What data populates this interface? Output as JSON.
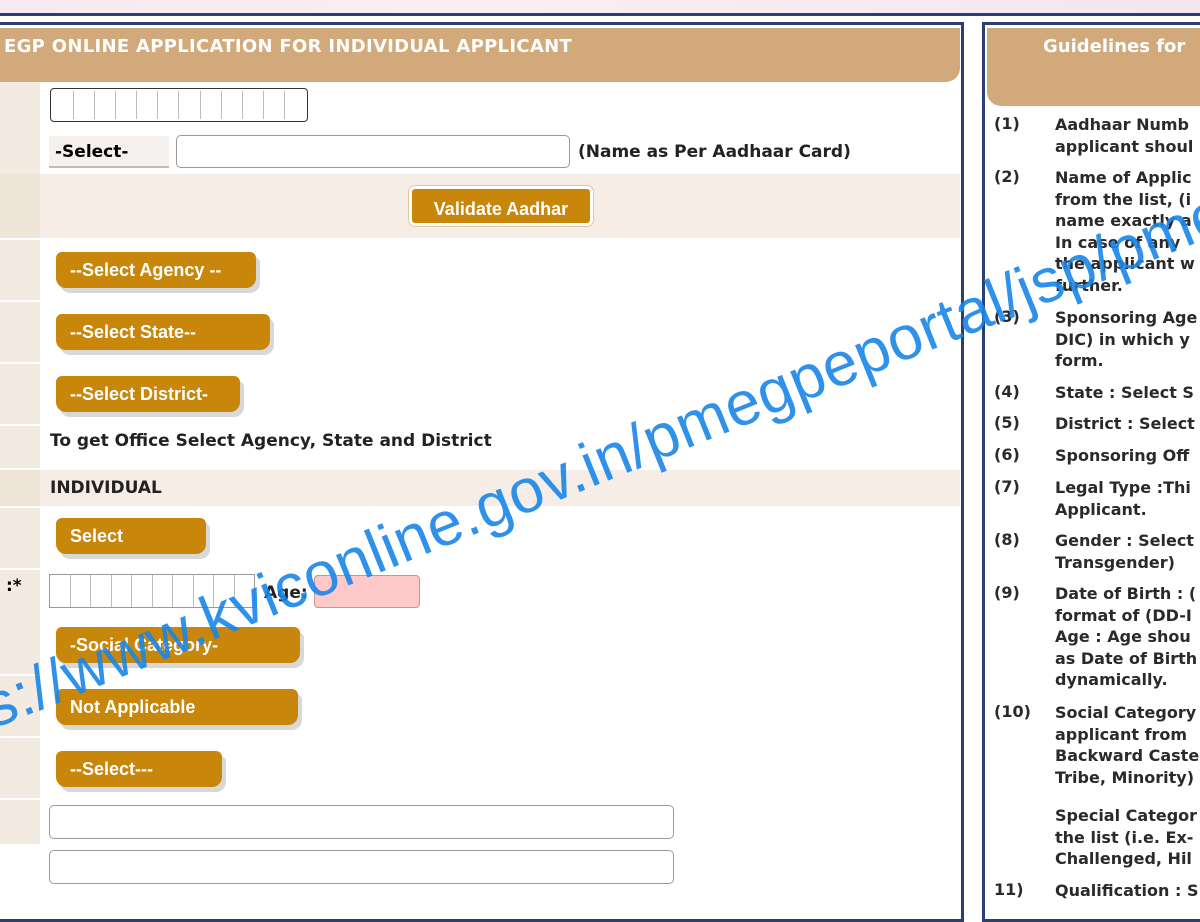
{
  "form": {
    "title": "EGP ONLINE APPLICATION FOR INDIVIDUAL APPLICANT",
    "title_select": "-Select-",
    "name_hint": "(Name as Per Aadhaar Card)",
    "validate_button": "Validate  Aadhar",
    "agency_select": "--Select Agency --",
    "state_select": "--Select State--",
    "district_select": "--Select District-",
    "office_hint": "To get Office Select Agency, State and District",
    "legal_type_value": "INDIVIDUAL",
    "gender_select": "Select",
    "dob_label": ":*",
    "age_label": "Age:",
    "social_category_select": "-Social Category-",
    "special_category_select": "Not Applicable",
    "qualification_select": "--Select---"
  },
  "guidelines": {
    "title": "Guidelines for",
    "items": [
      {
        "num": "(1)",
        "text": "Aadhaar Numb\napplicant shoul"
      },
      {
        "num": "(2)",
        "text": "Name of Applic\nfrom the list, (i\nname exactly a\nIn case of any\nthe applicant w\nfurther."
      },
      {
        "num": "(3)",
        "text": "Sponsoring Age\nDIC) in which y\nform."
      },
      {
        "num": "(4)",
        "text": "State : Select S"
      },
      {
        "num": "(5)",
        "text": "District : Select"
      },
      {
        "num": "(6)",
        "text": "Sponsoring Off"
      },
      {
        "num": "(7)",
        "text": "Legal Type :Thi\nApplicant."
      },
      {
        "num": "(8)",
        "text": "Gender : Select\nTransgender)"
      },
      {
        "num": "(9)",
        "text": "Date of Birth : (\nformat of (DD-I\nAge : Age shou\nas Date of Birth\ndynamically."
      },
      {
        "num": "(10)",
        "text": "Social Category\napplicant from\nBackward Caste\nTribe, Minority)"
      },
      {
        "num": "",
        "text": "Special Categor\nthe list (i.e. Ex-\nChallenged, Hil"
      },
      {
        "num": "11)",
        "text": "Qualification : S"
      }
    ]
  },
  "watermark": "ps://www.kviconline.gov.in/pmegpeportal/jsp/pmegponlin",
  "colors": {
    "button": "#c8860a",
    "header": "#d2a97a",
    "border": "#2c3f72",
    "watermark": "#1a86e8"
  }
}
